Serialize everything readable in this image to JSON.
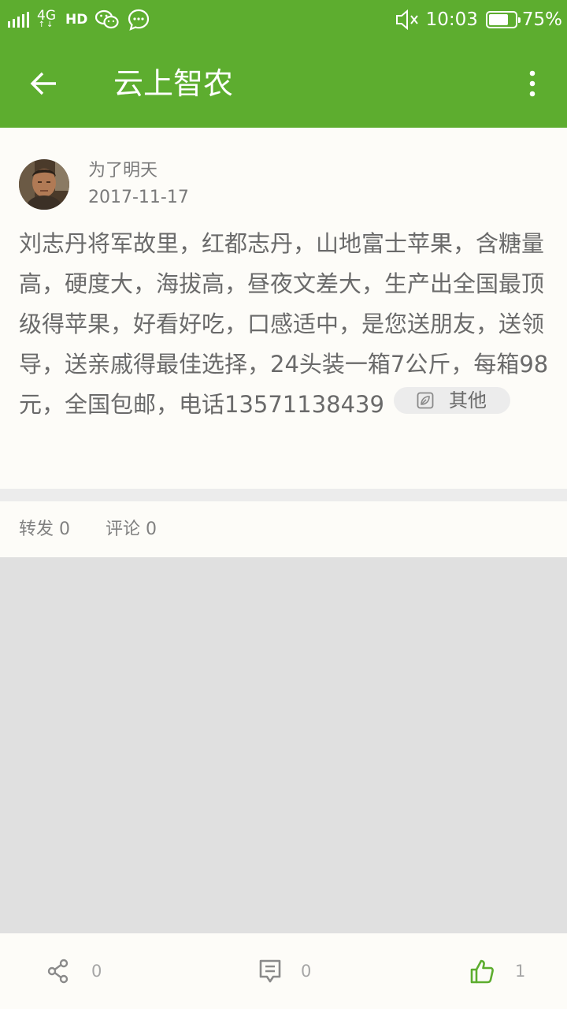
{
  "status_bar": {
    "network": "4G",
    "network_arrows": "↑↓",
    "hd": "HD",
    "time": "10:03",
    "battery": "75%",
    "battery_level": 0.75,
    "icons": [
      "signal-icon",
      "wechat-icon",
      "message-icon",
      "mute-icon",
      "battery-icon"
    ]
  },
  "app_bar": {
    "title": "云上智农",
    "icons": [
      "back-arrow-icon",
      "more-vertical-icon"
    ]
  },
  "post": {
    "author": "为了明天",
    "date": "2017-11-17",
    "content": "刘志丹将军故里，红都志丹，山地富士苹果，含糖量高，硬度大，海拔高，昼夜文差大，生产出全国最顶级得苹果，好看好吃，口感适中，是您送朋友，送领导，送亲戚得最佳选择，24头装一箱7公斤，每箱98元，全国包邮，电话13571138439",
    "tag": "其他",
    "tag_icon": "leaf-icon"
  },
  "stats": {
    "forward": "转发 0",
    "comment": "评论 0"
  },
  "bottom_bar": {
    "share_count": "0",
    "comment_count": "0",
    "like_count": "1",
    "accent_color": "#5dad2f"
  },
  "colors": {
    "primary": "#5dad2f",
    "background": "#e0e0e0",
    "card": "#fdfcf8"
  }
}
